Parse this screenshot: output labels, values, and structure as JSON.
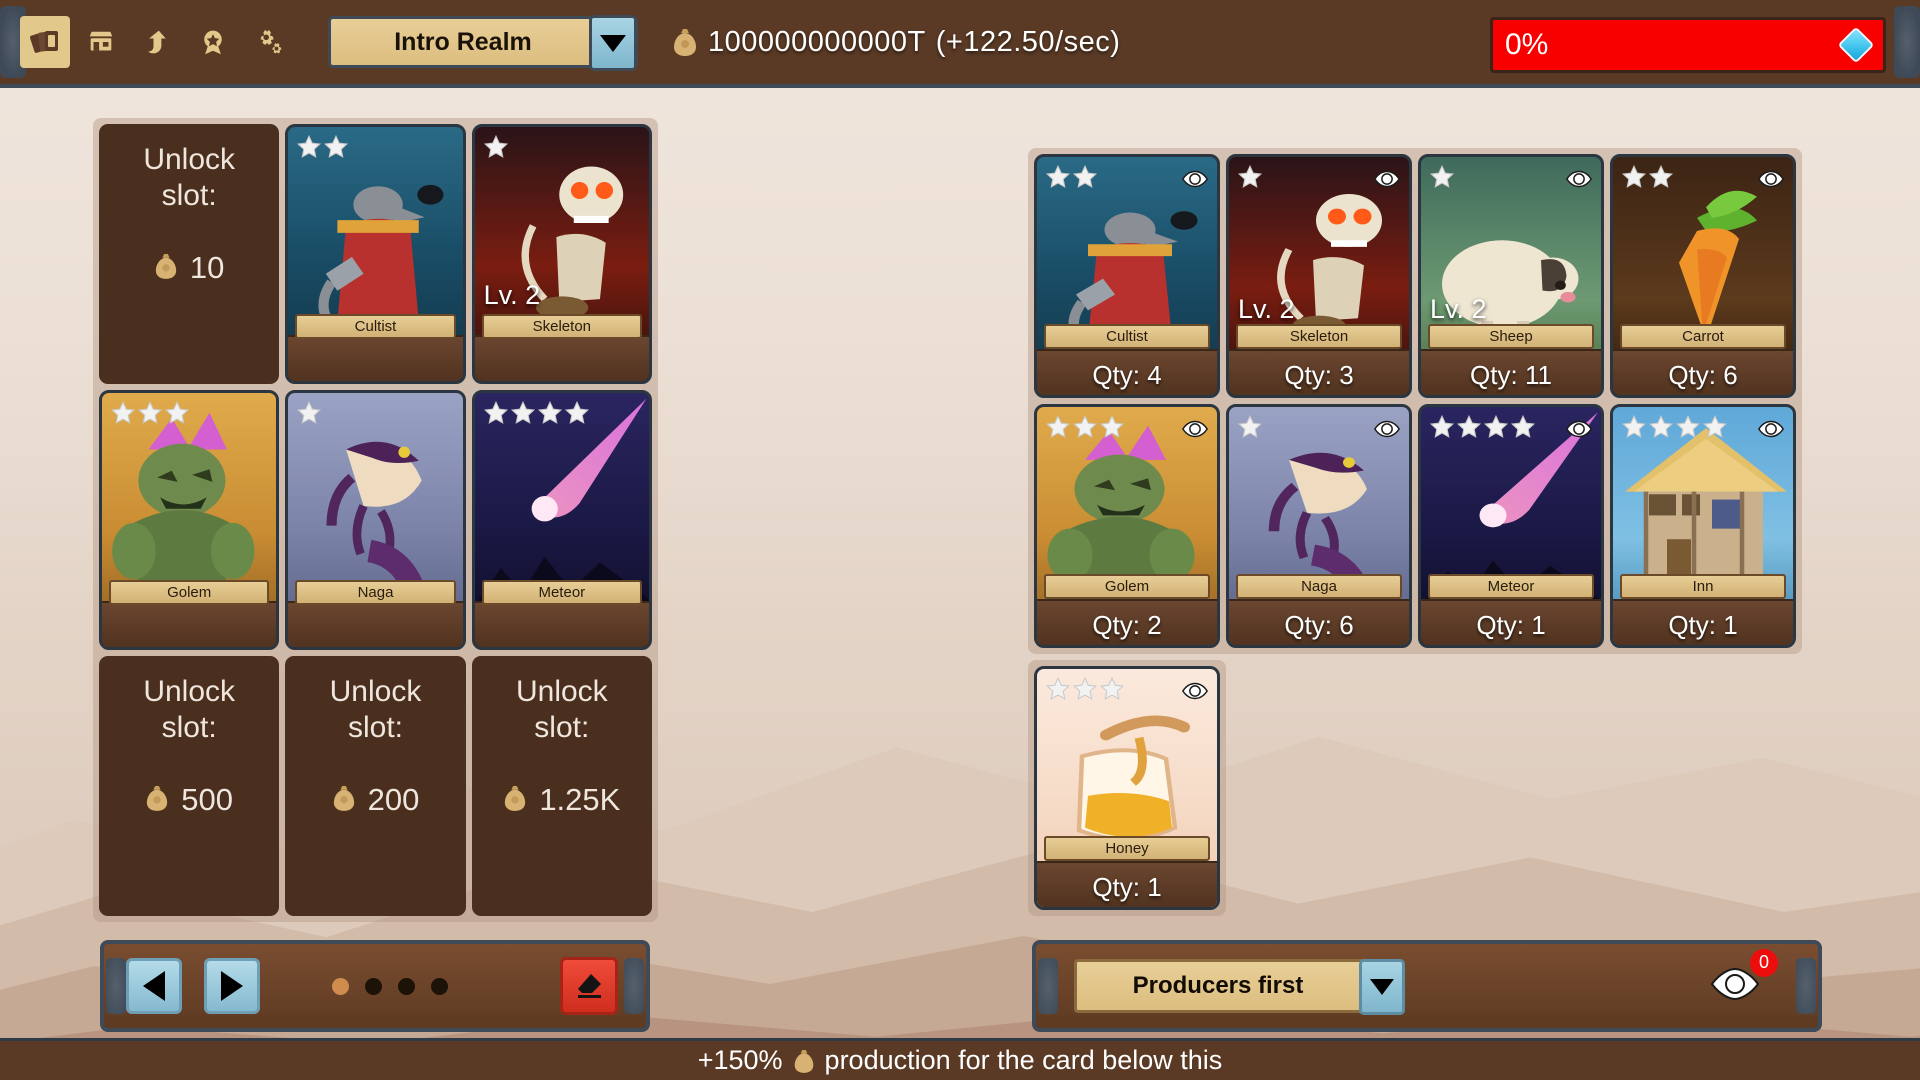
{
  "topbar": {
    "tools": [
      {
        "name": "cards-icon",
        "label": "Cards",
        "active": true
      },
      {
        "name": "shop-icon",
        "label": "Shop",
        "active": false
      },
      {
        "name": "upgrade-icon",
        "label": "Upgrade",
        "active": false
      },
      {
        "name": "medal-icon",
        "label": "Achievements",
        "active": false
      },
      {
        "name": "settings-icon",
        "label": "Settings",
        "active": false
      }
    ],
    "realm": "Intro Realm",
    "currency_amount": "100000000000T",
    "currency_rate": "(+122.50/sec)",
    "progress_label": "0%",
    "progress_percent": 0,
    "progress_color": "#f80000",
    "gem_color": "#12a8dd"
  },
  "deck": {
    "slots": [
      {
        "type": "locked",
        "unlock_label": "Unlock slot:",
        "cost": "10"
      },
      {
        "type": "card",
        "name": "Cultist",
        "stars": 2,
        "level": "",
        "art": "cultist"
      },
      {
        "type": "card",
        "name": "Skeleton",
        "stars": 1,
        "level": "Lv. 2",
        "art": "skeleton"
      },
      {
        "type": "card",
        "name": "Golem",
        "stars": 3,
        "level": "",
        "art": "golem"
      },
      {
        "type": "card",
        "name": "Naga",
        "stars": 1,
        "level": "",
        "art": "naga"
      },
      {
        "type": "card",
        "name": "Meteor",
        "stars": 4,
        "level": "",
        "art": "meteor"
      },
      {
        "type": "locked",
        "unlock_label": "Unlock slot:",
        "cost": "500"
      },
      {
        "type": "locked",
        "unlock_label": "Unlock slot:",
        "cost": "200"
      },
      {
        "type": "locked",
        "unlock_label": "Unlock slot:",
        "cost": "1.25K"
      }
    ],
    "nav": {
      "prev": "◀",
      "next": "▶",
      "pages": [
        true,
        false,
        false,
        false
      ],
      "erase_label": "Clear deck"
    }
  },
  "collection": {
    "cards": [
      {
        "name": "Cultist",
        "stars": 2,
        "level": "",
        "qty": "Qty: 4",
        "art": "cultist"
      },
      {
        "name": "Skeleton",
        "stars": 1,
        "level": "Lv. 2",
        "qty": "Qty: 3",
        "art": "skeleton"
      },
      {
        "name": "Sheep",
        "stars": 1,
        "level": "Lv. 2",
        "qty": "Qty: 11",
        "art": "sheep"
      },
      {
        "name": "Carrot",
        "stars": 2,
        "level": "",
        "qty": "Qty: 6",
        "art": "carrot"
      },
      {
        "name": "Golem",
        "stars": 3,
        "level": "",
        "qty": "Qty: 2",
        "art": "golem"
      },
      {
        "name": "Naga",
        "stars": 1,
        "level": "",
        "qty": "Qty: 6",
        "art": "naga"
      },
      {
        "name": "Meteor",
        "stars": 4,
        "level": "",
        "qty": "Qty: 1",
        "art": "meteor"
      },
      {
        "name": "Inn",
        "stars": 4,
        "level": "",
        "qty": "Qty: 1",
        "art": "inn"
      }
    ],
    "extra": [
      {
        "name": "Honey",
        "stars": 3,
        "level": "",
        "qty": "Qty: 1",
        "art": "honey"
      }
    ],
    "sort_label": "Producers first",
    "hidden_count": "0"
  },
  "footer": {
    "text_before": "+150%",
    "text_after": "production for the card below this"
  }
}
